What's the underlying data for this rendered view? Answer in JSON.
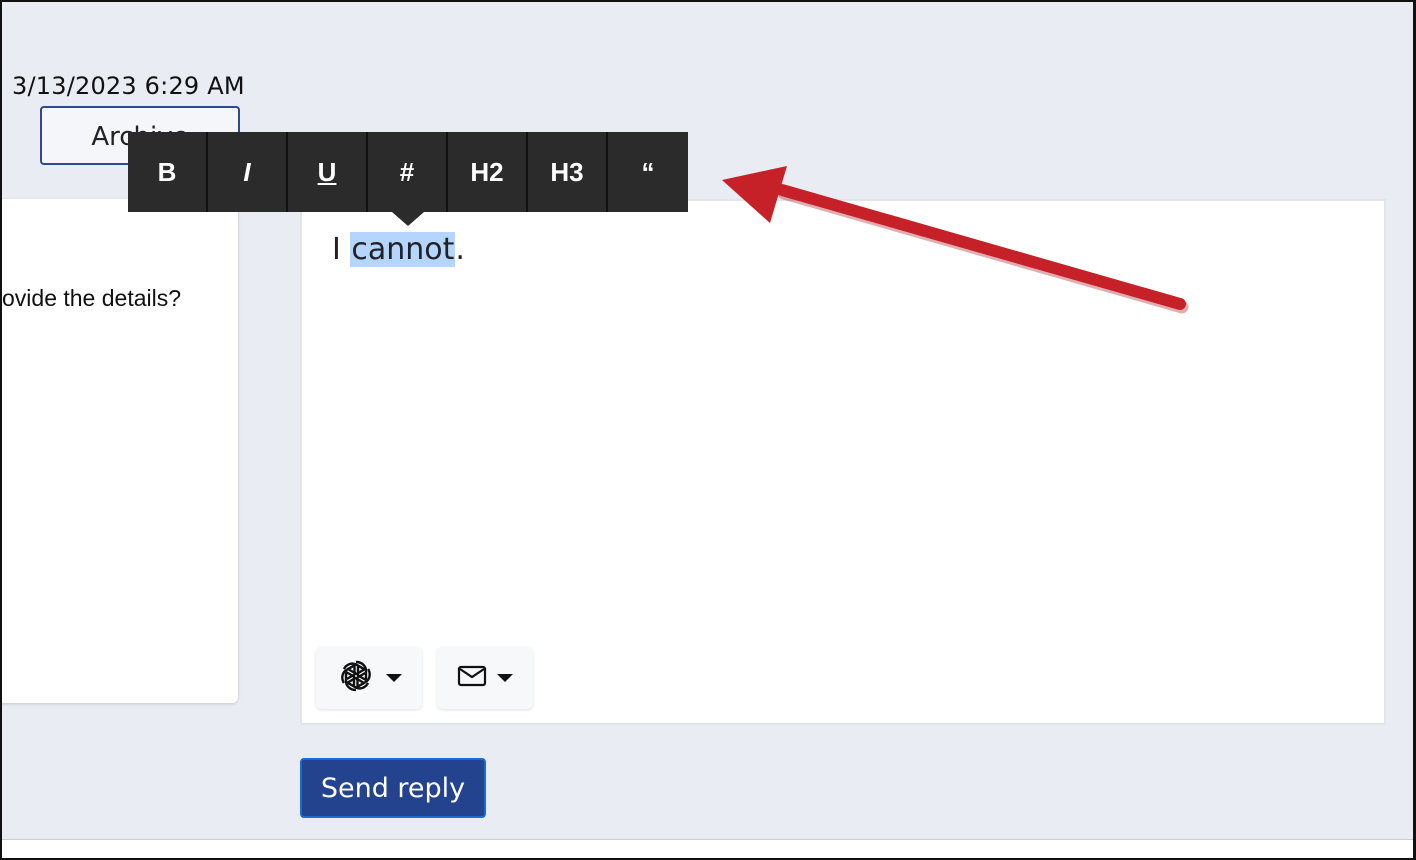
{
  "header": {
    "timestamp": "3/13/2023 6:29 AM",
    "archive_label": "Archive"
  },
  "message": {
    "visible_text": "ovide the details?"
  },
  "editor": {
    "text_before": "I ",
    "selected_text": "cannot",
    "text_after": "."
  },
  "format_toolbar": {
    "buttons": [
      {
        "label": "B",
        "name": "bold"
      },
      {
        "label": "I",
        "name": "italic"
      },
      {
        "label": "U",
        "name": "underline"
      },
      {
        "label": "#",
        "name": "heading-1"
      },
      {
        "label": "H2",
        "name": "heading-2"
      },
      {
        "label": "H3",
        "name": "heading-3"
      },
      {
        "label": "“",
        "name": "quote"
      }
    ]
  },
  "editor_tools": {
    "ai_icon": "openai-icon",
    "template_icon": "envelope-icon"
  },
  "actions": {
    "send_label": "Send reply"
  },
  "colors": {
    "background": "#e9ecf3",
    "primary": "#23438f",
    "toolbar": "#2b2b2b",
    "selection": "#b4d5fe",
    "annotation_arrow": "#c62028"
  }
}
